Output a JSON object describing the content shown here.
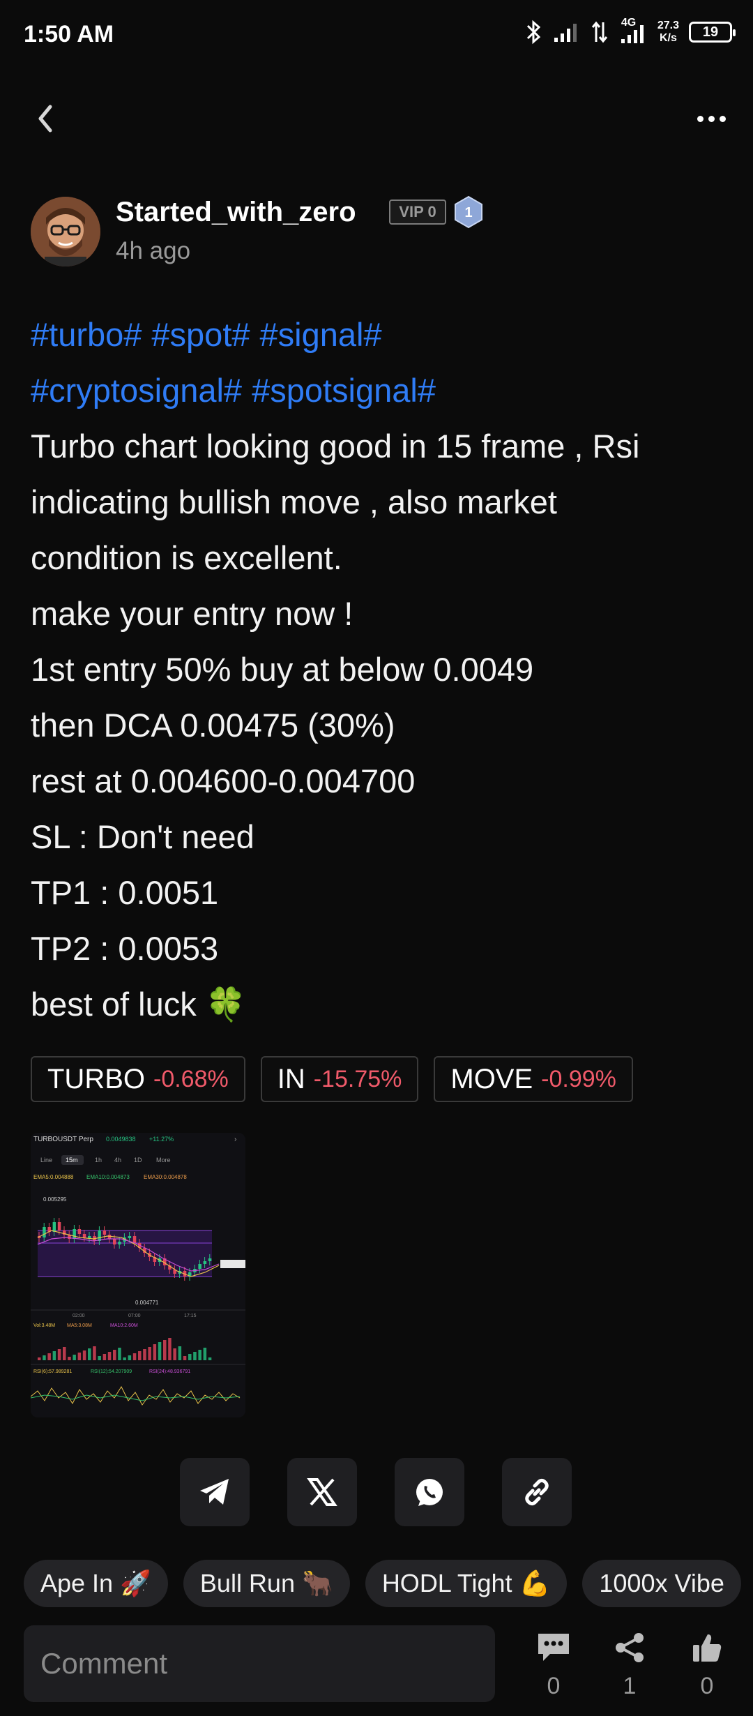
{
  "status_bar": {
    "time": "1:50 AM",
    "network_type": "4G",
    "speed_value": "27.3",
    "speed_unit": "K/s",
    "battery": "19",
    "icons": [
      "bluetooth-icon",
      "signal-icon",
      "data-transfer-icon",
      "signal-4g-icon"
    ]
  },
  "nav": {
    "back_icon": "chevron-left-icon",
    "more_icon": "more-dots-icon"
  },
  "author": {
    "name": "Started_with_zero",
    "vip": "VIP 0",
    "level": "1",
    "time": "4h ago"
  },
  "post": {
    "hashtags_line1": [
      "#turbo#",
      "#spot#",
      "#signal#"
    ],
    "hashtags_line2": [
      "#cryptosignal#",
      "#spotsignal#"
    ],
    "lines": [
      "Turbo chart looking good in 15 frame , Rsi",
      "indicating bullish move , also market",
      "condition is excellent.",
      "make your entry now !",
      "1st entry 50% buy at below 0.0049",
      "then DCA 0.00475 (30%)",
      "rest at 0.004600-0.004700",
      "SL : Don't need",
      "TP1 : 0.0051",
      "TP2 : 0.0053",
      "best of luck 🍀"
    ]
  },
  "tickers": [
    {
      "name": "TURBO",
      "change": "-0.68%"
    },
    {
      "name": "IN",
      "change": "-15.75%"
    },
    {
      "name": "MOVE",
      "change": "-0.99%"
    }
  ],
  "chart_image": {
    "symbol": "TURBOUSDT Perp",
    "price": "0.0049838",
    "change": "+11.27%",
    "tabs": [
      "Line",
      "15m",
      "1h",
      "4h",
      "1D",
      "More"
    ],
    "active_tab": "15m",
    "ema_labels": [
      "EMA5:0.004888",
      "EMA10:0.004873",
      "EMA30:0.004878"
    ],
    "high_label": "0.005295",
    "low_label": "0.004771",
    "vol_labels": [
      "Vol:3.48M",
      "MA5:3.08M",
      "MA10:2.60M"
    ],
    "rsi_labels": [
      "RSI(6):57.989281",
      "RSI(12):54.207909",
      "RSI(24):48.936791"
    ],
    "time_labels": [
      "02:00",
      "07:00",
      "17:15"
    ],
    "colors": {
      "up": "#26c281",
      "down": "#e2455b",
      "band": "#6c2fb3",
      "ema5": "#e8c24a",
      "ema10": "#36c26b",
      "ema30": "#c94fd6"
    }
  },
  "share_buttons": [
    {
      "name": "telegram",
      "icon": "telegram-icon"
    },
    {
      "name": "x",
      "icon": "x-icon"
    },
    {
      "name": "whatsapp",
      "icon": "whatsapp-icon"
    },
    {
      "name": "copy-link",
      "icon": "link-icon"
    }
  ],
  "reactions": [
    "Ape In 🚀",
    "Bull Run 🐂",
    "HODL Tight 💪",
    "1000x Vibe"
  ],
  "comment": {
    "placeholder": "Comment"
  },
  "stats": {
    "comments": "0",
    "shares": "1",
    "likes": "0"
  },
  "colors": {
    "background": "#0b0b0b",
    "hashtag": "#2f7cf6",
    "negative": "#f05a6a",
    "muted": "#9a9a9a",
    "level_badge": "#8ea7d8"
  }
}
